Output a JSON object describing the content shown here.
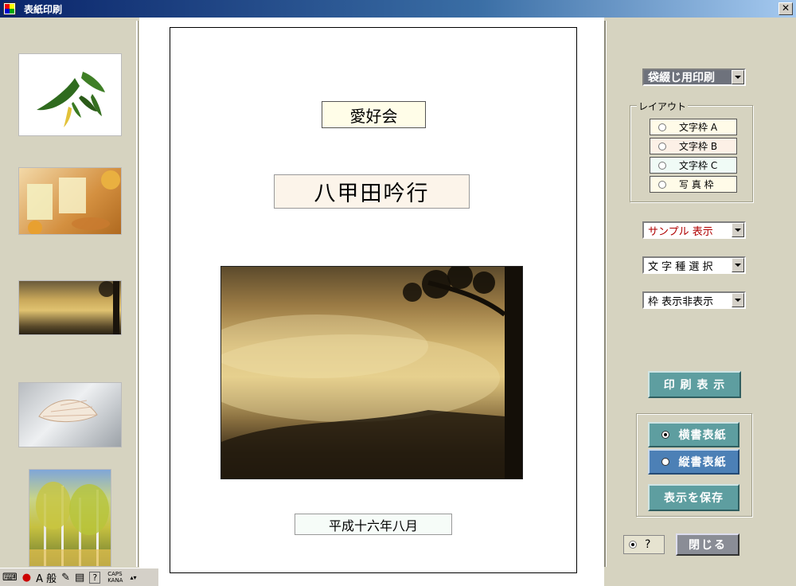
{
  "window": {
    "title": "表紙印刷",
    "close_label": "✕"
  },
  "cover": {
    "group_name": "愛好会",
    "title": "八甲田吟行",
    "date": "平成十六年八月"
  },
  "right": {
    "print_mode": "袋綴じ用印刷",
    "layout_legend": "レイアウト",
    "layout_options": [
      "文字枠 A",
      "文字枠 B",
      "文字枠 C",
      "写 真 枠"
    ],
    "sample_display": "サンプル 表示",
    "char_type": "文 字 種 選 択",
    "frame_display": "枠 表示非表示",
    "print_preview": "印 刷 表 示",
    "horizontal_cover": "横書表紙",
    "vertical_cover": "縦書表紙",
    "save_display": "表示を保存",
    "help_label": "?",
    "close_button": "閉じる"
  },
  "ime": {
    "mode": "A 般",
    "caps": "CAPS",
    "kana": "KANA",
    "help": "?"
  },
  "colors": {
    "accent_teal": "#5e9ea0",
    "accent_blue": "#4c80b6",
    "sample_red": "#b00000"
  }
}
